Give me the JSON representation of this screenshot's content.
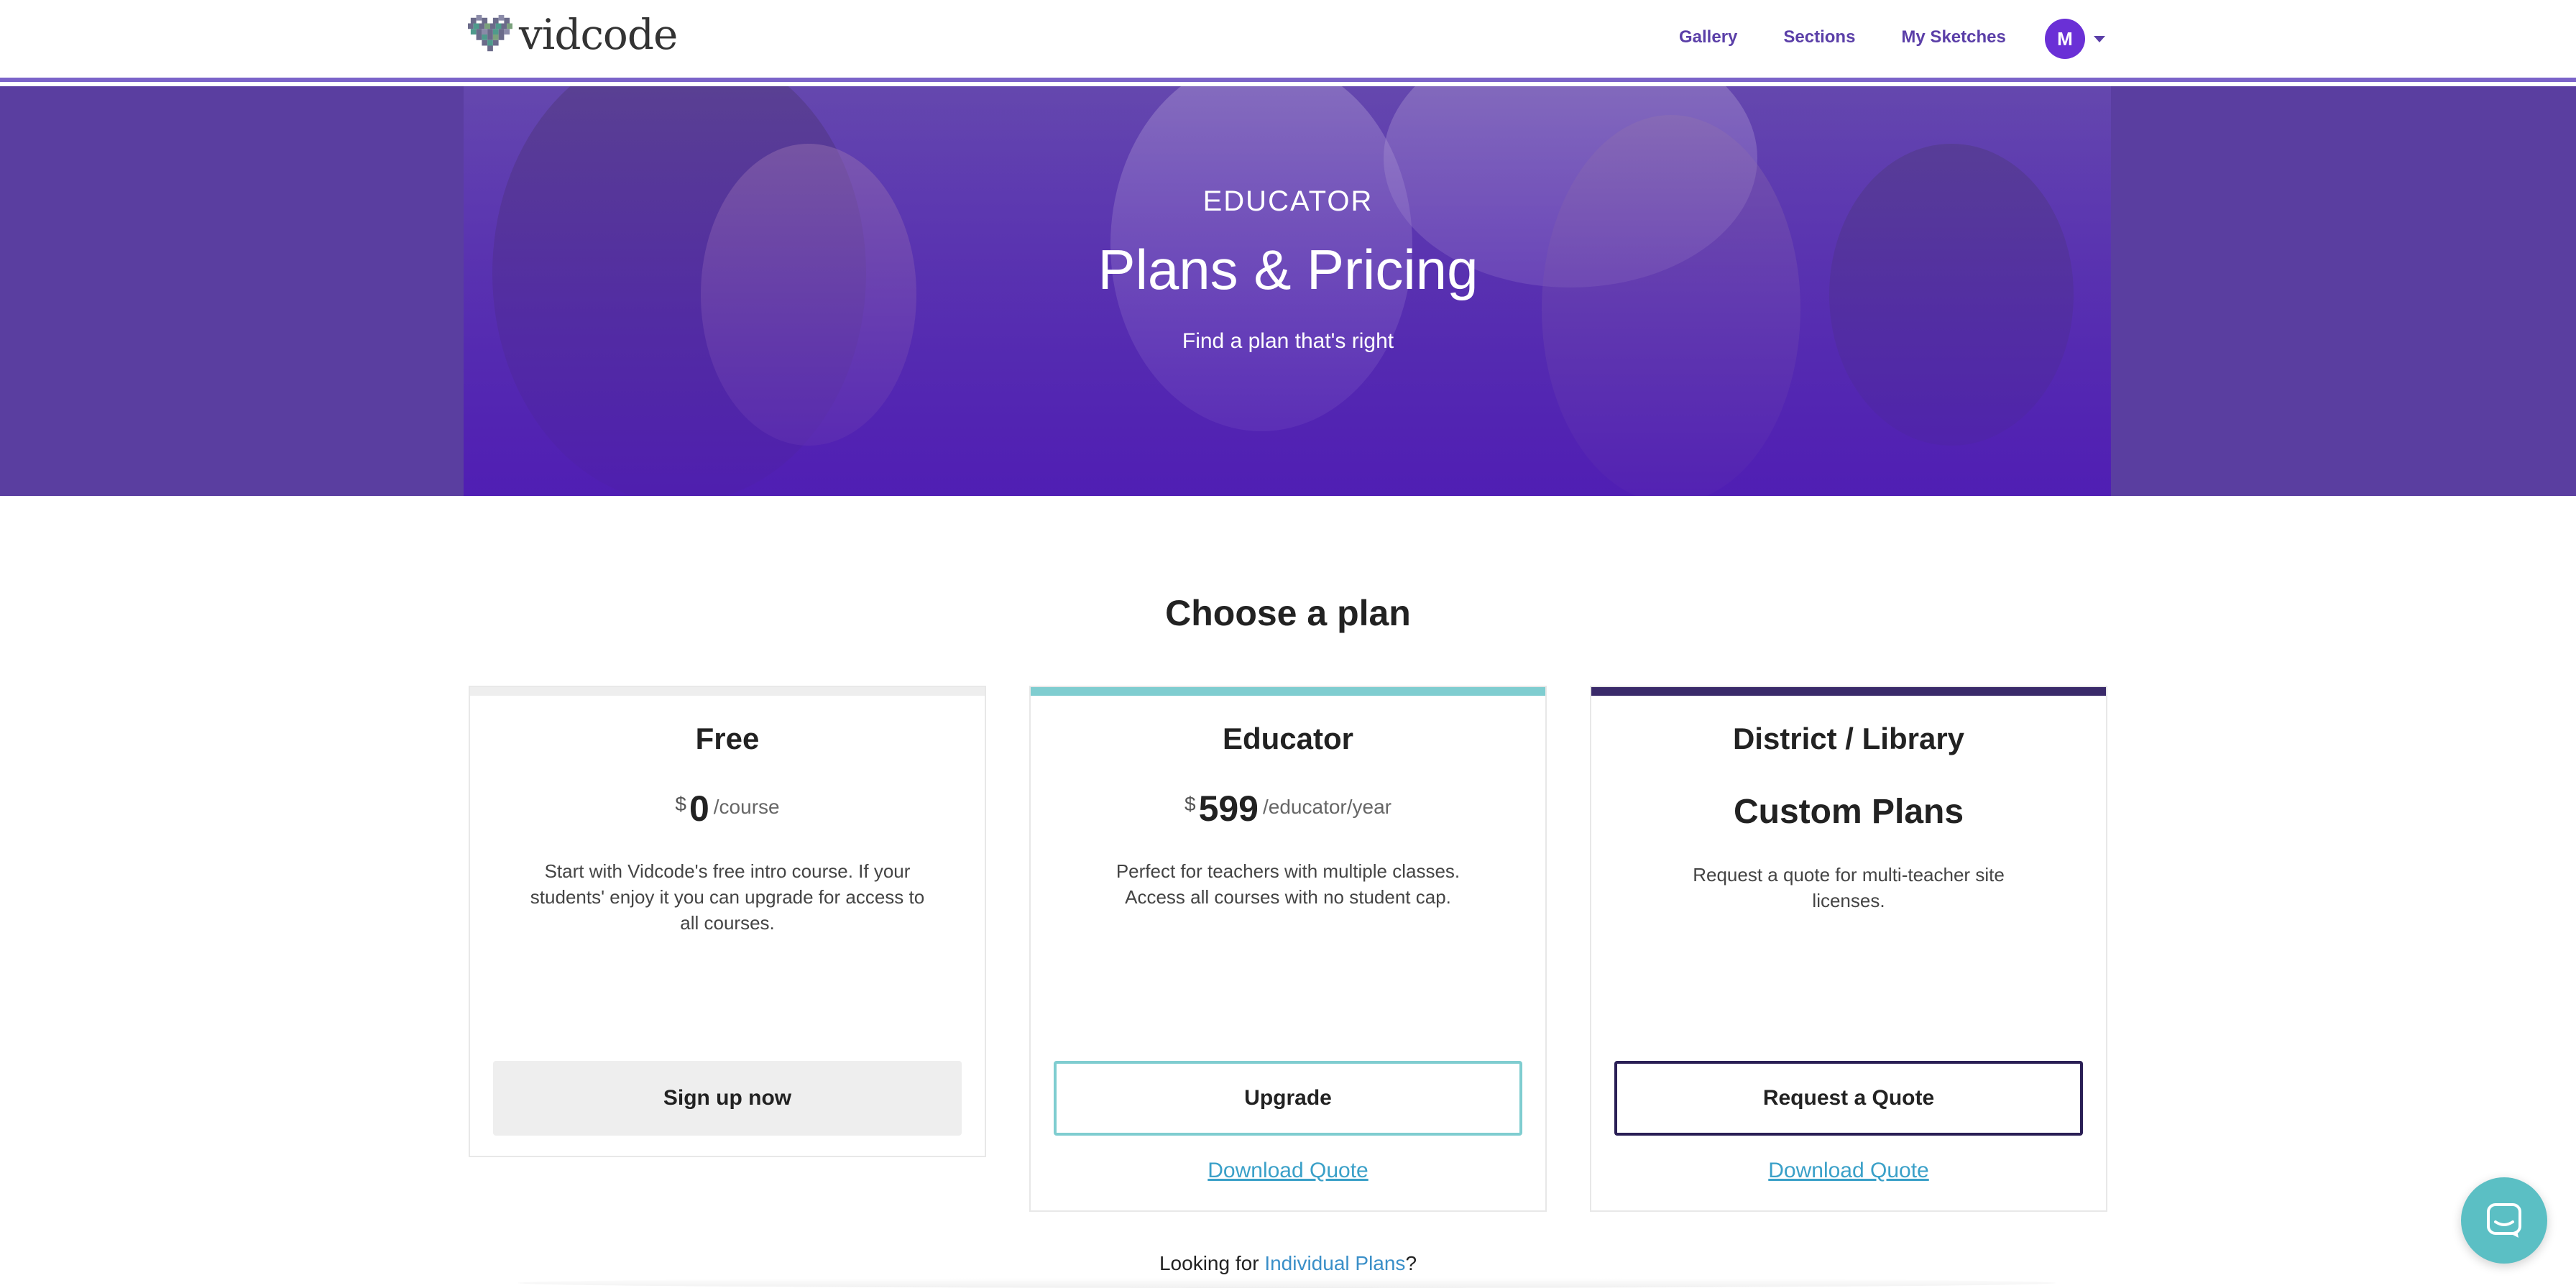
{
  "nav": {
    "logo_text": "vidcode",
    "links": [
      "Gallery",
      "Sections",
      "My Sketches"
    ],
    "avatar_initial": "M"
  },
  "hero": {
    "eyebrow": "EDUCATOR",
    "title": "Plans & Pricing",
    "subtitle": "Find a plan that's right"
  },
  "main": {
    "title": "Choose a plan",
    "plans": [
      {
        "name": "Free",
        "currency": "$",
        "amount": "0",
        "unit": "/course",
        "description": "Start with Vidcode's free intro course. If your students' enjoy it you can upgrade for access to all courses.",
        "button": "Sign up now",
        "accent": "#eeeeee"
      },
      {
        "name": "Educator",
        "currency": "$",
        "amount": "599",
        "unit": "/educator/year",
        "description": "Perfect for teachers with multiple classes. Access all courses with no student cap.",
        "button": "Upgrade",
        "link": "Download Quote",
        "accent": "#7fcdd0"
      },
      {
        "name": "District / Library",
        "headline": "Custom Plans",
        "description": "Request a quote for multi-teacher site licenses.",
        "button": "Request a Quote",
        "link": "Download Quote",
        "accent": "#3a2a6a"
      }
    ],
    "footer_prefix": "Looking for ",
    "footer_link": "Individual Plans",
    "footer_suffix": "?"
  },
  "colors": {
    "brand_purple": "#5b3fa8",
    "hero_purple": "#5a3ea0",
    "teal": "#7fcdd0",
    "dark_navy": "#2a1f55",
    "link_blue": "#3aa0c8"
  },
  "icons": {
    "logo": "pixel-heart-icon",
    "chat": "chat-icon",
    "dropdown": "chevron-down-icon"
  }
}
